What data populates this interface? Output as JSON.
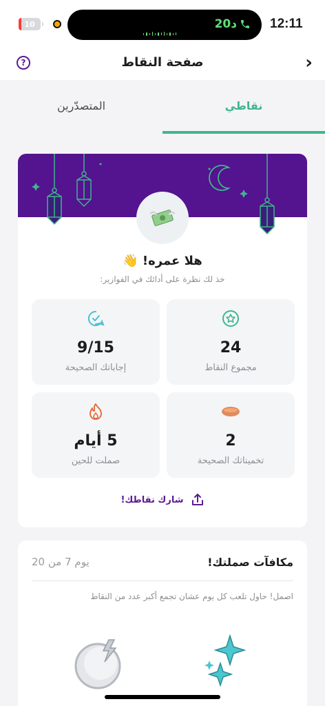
{
  "status": {
    "time": "12:11",
    "battery": "10",
    "call_duration": "20د"
  },
  "header": {
    "title": "صفحة النقاط"
  },
  "tabs": {
    "mine": "نقاطي",
    "leaders": "المتصدّرين"
  },
  "profile": {
    "greeting": "هلا عمره! 👋",
    "subtitle": "خذ لك نظرة على أدائك في الفوازير:"
  },
  "stats": {
    "total": {
      "value": "24",
      "label": "مجموع النقاط"
    },
    "answers": {
      "value": "9/15",
      "label": "إجاباتك الصحيحة"
    },
    "guesses": {
      "value": "2",
      "label": "تخميناتك الصحيحة"
    },
    "streak": {
      "value": "5 أيام",
      "label": "صملت للحين"
    }
  },
  "share": {
    "label": "شارك نقاطك!"
  },
  "streak_card": {
    "title": "مكافآت صملتك!",
    "day": "يوم 7 من 20",
    "description": "اصمل! حاول تلعب كل يوم عشان تجمع أكبر عدد من النقاط"
  },
  "colors": {
    "accent": "#3fb68b",
    "brand_purple": "#54138f",
    "link_purple": "#5b1a91"
  },
  "icons": [
    "help-icon",
    "back-icon",
    "star-badge-icon",
    "chat-check-icon",
    "bean-icon",
    "flame-icon",
    "share-icon",
    "money-icon",
    "moon-icon",
    "lantern-icon",
    "sparkles-icon"
  ]
}
